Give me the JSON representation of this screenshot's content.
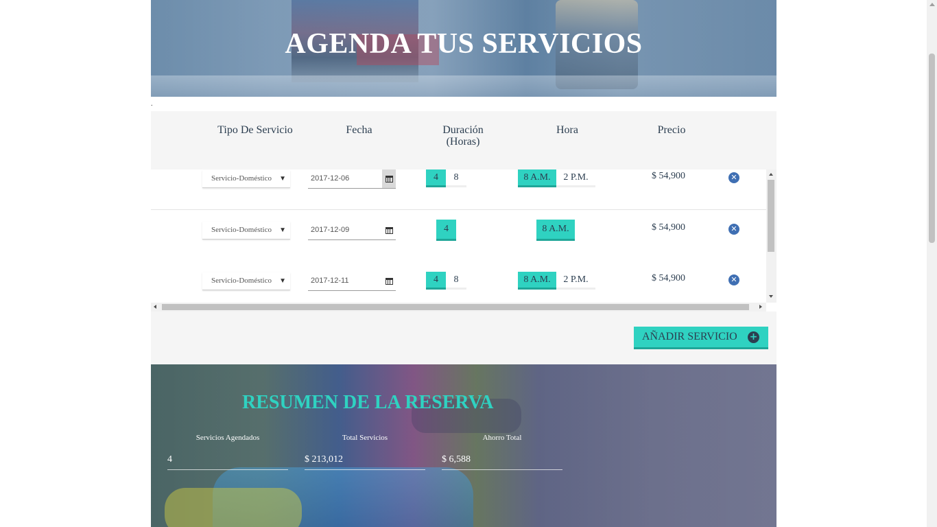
{
  "hero": {
    "title": "AGENDA TUS SERVICIOS"
  },
  "separator_dot": ".",
  "table": {
    "headers": {
      "service_type": "Tipo De Servicio",
      "date": "Fecha",
      "duration_line1": "Duración",
      "duration_line2": "(Horas)",
      "hour": "Hora",
      "price": "Precio"
    },
    "rows": [
      {
        "service": "Servicio-Doméstico",
        "date": "2017-12-06",
        "duration_options": [
          "4",
          "8"
        ],
        "duration_selected": "4",
        "hour_options": [
          "8 A.M.",
          "2 P.M."
        ],
        "hour_selected": "8 A.M.",
        "price": "$ 54,900"
      },
      {
        "service": "Servicio-Doméstico",
        "date": "2017-12-09",
        "duration_options": [
          "4"
        ],
        "duration_selected": "4",
        "hour_options": [
          "8 A.M."
        ],
        "hour_selected": "8 A.M.",
        "price": "$ 54,900"
      },
      {
        "service": "Servicio-Doméstico",
        "date": "2017-12-11",
        "duration_options": [
          "4",
          "8"
        ],
        "duration_selected": "4",
        "hour_options": [
          "8 A.M.",
          "2 P.M."
        ],
        "hour_selected": "8 A.M.",
        "price": "$ 54,900"
      }
    ],
    "select_caret": "▼",
    "remove_glyph": "✕",
    "add_button": {
      "label": "AÑADIR SERVICIO",
      "icon_glyph": "+"
    }
  },
  "summary": {
    "title": "RESUMEN DE LA RESERVA",
    "stats": [
      {
        "label": "Servicios Agendados",
        "value": "4"
      },
      {
        "label": "Total Servicios",
        "value": "$ 213,012"
      },
      {
        "label": "Ahorro Total",
        "value": "$ 6,588"
      }
    ]
  },
  "icons": {
    "calendar": "calendar-icon",
    "remove": "remove-circle-icon",
    "add": "plus-circle-icon",
    "dropdown": "caret-down-icon"
  },
  "colors": {
    "accent_teal": "#2fd2c1",
    "text_dark": "#2c3e50",
    "remove_blue": "#3f6fb3",
    "panel_gray": "#f5f5f5"
  }
}
